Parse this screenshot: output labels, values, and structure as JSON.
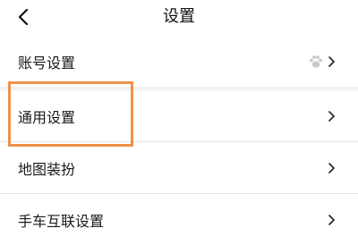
{
  "header": {
    "title": "设置",
    "back_icon": "chevron-left-icon"
  },
  "settings": {
    "items": [
      {
        "label": "账号设置",
        "icon": "paw-icon"
      },
      {
        "label": "通用设置"
      },
      {
        "label": "地图装扮"
      },
      {
        "label": "手车互联设置"
      }
    ],
    "chevron_icon": "chevron-right-icon"
  },
  "annotation": {
    "highlight_color": "#f0914a",
    "highlighted_item": "通用设置"
  }
}
